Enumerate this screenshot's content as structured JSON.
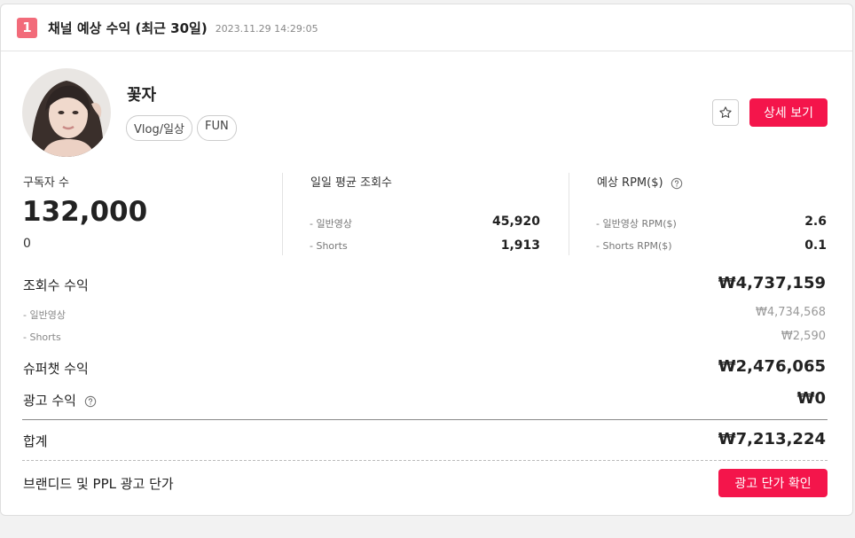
{
  "header": {
    "rank": "1",
    "title": "채널 예상 수익 (최근 30일)",
    "date": "2023.11.29 14:29:05"
  },
  "channel": {
    "name": "꽃자",
    "tags": [
      "Vlog/일상",
      "FUN"
    ],
    "detail_button": "상세 보기"
  },
  "subscribers": {
    "label": "구독자 수",
    "value": "132,000",
    "delta": "0"
  },
  "daily_views": {
    "label": "일일 평균 조회수",
    "rows": [
      {
        "label": "- 일반영상",
        "value": "45,920"
      },
      {
        "label": "- Shorts",
        "value": "1,913"
      }
    ]
  },
  "rpm": {
    "label": "예상 RPM($)",
    "rows": [
      {
        "label": "- 일반영상 RPM($)",
        "value": "2.6"
      },
      {
        "label": "- Shorts RPM($)",
        "value": "0.1"
      }
    ]
  },
  "revenue": {
    "views_label": "조회수 수익",
    "views_value": "₩4,737,159",
    "views_sub": [
      {
        "label": "- 일반영상",
        "value": "₩4,734,568"
      },
      {
        "label": "- Shorts",
        "value": "₩2,590"
      }
    ],
    "superchat_label": "슈퍼챗 수익",
    "superchat_value": "₩2,476,065",
    "ads_label": "광고 수익",
    "ads_value": "₩0",
    "total_label": "합계",
    "total_value": "₩7,213,224"
  },
  "branded": {
    "label": "브랜디드 및 PPL 광고 단가",
    "button": "광고 단가 확인"
  },
  "colors": {
    "accent": "#f4154b",
    "rank_badge": "#f26b7a"
  },
  "icons": [
    "star-icon",
    "help-icon"
  ]
}
